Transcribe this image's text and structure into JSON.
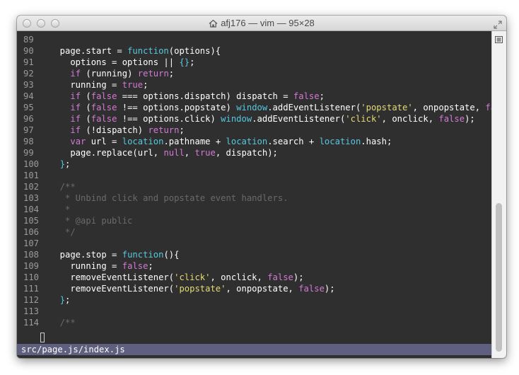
{
  "window": {
    "title": "afj176 — vim — 95×28"
  },
  "colors": {
    "background": "#2f2f2f",
    "text": "#ffffff",
    "line_number": "#9a9a9a",
    "keyword": "#d478d6",
    "function": "#56c8e0",
    "string": "#e6db74",
    "comment": "#6a6a6a",
    "brace": "#56c8e0",
    "status_bar": "#5f5f7f"
  },
  "editor": {
    "lines": [
      {
        "n": "89",
        "tokens": []
      },
      {
        "n": "90",
        "tokens": [
          [
            "t",
            "  page.start = "
          ],
          [
            "fn",
            "function"
          ],
          [
            "t",
            "(options){"
          ]
        ]
      },
      {
        "n": "91",
        "tokens": [
          [
            "t",
            "    options = options || "
          ],
          [
            "br",
            "{}"
          ],
          [
            "t",
            ";"
          ]
        ]
      },
      {
        "n": "92",
        "tokens": [
          [
            "t",
            "    "
          ],
          [
            "kw",
            "if"
          ],
          [
            "t",
            " (running) "
          ],
          [
            "kw",
            "return"
          ],
          [
            "t",
            ";"
          ]
        ]
      },
      {
        "n": "93",
        "tokens": [
          [
            "t",
            "    running = "
          ],
          [
            "kw",
            "true"
          ],
          [
            "t",
            ";"
          ]
        ]
      },
      {
        "n": "94",
        "tokens": [
          [
            "t",
            "    "
          ],
          [
            "kw",
            "if"
          ],
          [
            "t",
            " ("
          ],
          [
            "kw",
            "false"
          ],
          [
            "t",
            " === options.dispatch) dispatch = "
          ],
          [
            "kw",
            "false"
          ],
          [
            "t",
            ";"
          ]
        ]
      },
      {
        "n": "95",
        "tokens": [
          [
            "t",
            "    "
          ],
          [
            "kw",
            "if"
          ],
          [
            "t",
            " ("
          ],
          [
            "kw",
            "false"
          ],
          [
            "t",
            " !== options.popstate) "
          ],
          [
            "fn",
            "window"
          ],
          [
            "t",
            ".addEventListener("
          ],
          [
            "str",
            "'popstate'"
          ],
          [
            "t",
            ", onpopstate, "
          ],
          [
            "kw",
            "false"
          ],
          [
            "t",
            ");"
          ]
        ]
      },
      {
        "n": "96",
        "tokens": [
          [
            "t",
            "    "
          ],
          [
            "kw",
            "if"
          ],
          [
            "t",
            " ("
          ],
          [
            "kw",
            "false"
          ],
          [
            "t",
            " !== options.click) "
          ],
          [
            "fn",
            "window"
          ],
          [
            "t",
            ".addEventListener("
          ],
          [
            "str",
            "'click'"
          ],
          [
            "t",
            ", onclick, "
          ],
          [
            "kw",
            "false"
          ],
          [
            "t",
            ");"
          ]
        ]
      },
      {
        "n": "97",
        "tokens": [
          [
            "t",
            "    "
          ],
          [
            "kw",
            "if"
          ],
          [
            "t",
            " (!dispatch) "
          ],
          [
            "kw",
            "return"
          ],
          [
            "t",
            ";"
          ]
        ]
      },
      {
        "n": "98",
        "tokens": [
          [
            "t",
            "    "
          ],
          [
            "kw",
            "var"
          ],
          [
            "t",
            " url = "
          ],
          [
            "fn",
            "location"
          ],
          [
            "t",
            ".pathname + "
          ],
          [
            "fn",
            "location"
          ],
          [
            "t",
            ".search + "
          ],
          [
            "fn",
            "location"
          ],
          [
            "t",
            ".hash;"
          ]
        ]
      },
      {
        "n": "99",
        "tokens": [
          [
            "t",
            "    page.replace(url, "
          ],
          [
            "kw",
            "null"
          ],
          [
            "t",
            ", "
          ],
          [
            "kw",
            "true"
          ],
          [
            "t",
            ", dispatch);"
          ]
        ]
      },
      {
        "n": "100",
        "tokens": [
          [
            "t",
            "  "
          ],
          [
            "br",
            "}"
          ],
          [
            "t",
            ";"
          ]
        ]
      },
      {
        "n": "101",
        "tokens": []
      },
      {
        "n": "102",
        "tokens": [
          [
            "cm",
            "  /**"
          ]
        ]
      },
      {
        "n": "103",
        "tokens": [
          [
            "cm",
            "   * Unbind click and popstate event handlers."
          ]
        ]
      },
      {
        "n": "104",
        "tokens": [
          [
            "cm",
            "   *"
          ]
        ]
      },
      {
        "n": "105",
        "tokens": [
          [
            "cm",
            "   * @api public"
          ]
        ]
      },
      {
        "n": "106",
        "tokens": [
          [
            "cm",
            "   */"
          ]
        ]
      },
      {
        "n": "107",
        "tokens": []
      },
      {
        "n": "108",
        "tokens": [
          [
            "t",
            "  page.stop = "
          ],
          [
            "fn",
            "function"
          ],
          [
            "t",
            "(){"
          ]
        ]
      },
      {
        "n": "109",
        "tokens": [
          [
            "t",
            "    running = "
          ],
          [
            "kw",
            "false"
          ],
          [
            "t",
            ";"
          ]
        ]
      },
      {
        "n": "110",
        "tokens": [
          [
            "t",
            "    removeEventListener("
          ],
          [
            "str",
            "'click'"
          ],
          [
            "t",
            ", onclick, "
          ],
          [
            "kw",
            "false"
          ],
          [
            "t",
            ");"
          ]
        ]
      },
      {
        "n": "111",
        "tokens": [
          [
            "t",
            "    removeEventListener("
          ],
          [
            "str",
            "'popstate'"
          ],
          [
            "t",
            ", onpopstate, "
          ],
          [
            "kw",
            "false"
          ],
          [
            "t",
            ");"
          ]
        ]
      },
      {
        "n": "112",
        "tokens": [
          [
            "t",
            "  "
          ],
          [
            "br",
            "}"
          ],
          [
            "t",
            ";"
          ]
        ]
      },
      {
        "n": "113",
        "tokens": []
      },
      {
        "n": "114",
        "tokens": [
          [
            "cm",
            "  /**"
          ]
        ]
      }
    ]
  },
  "status_bar": {
    "text": "src/page.js/index.js"
  }
}
